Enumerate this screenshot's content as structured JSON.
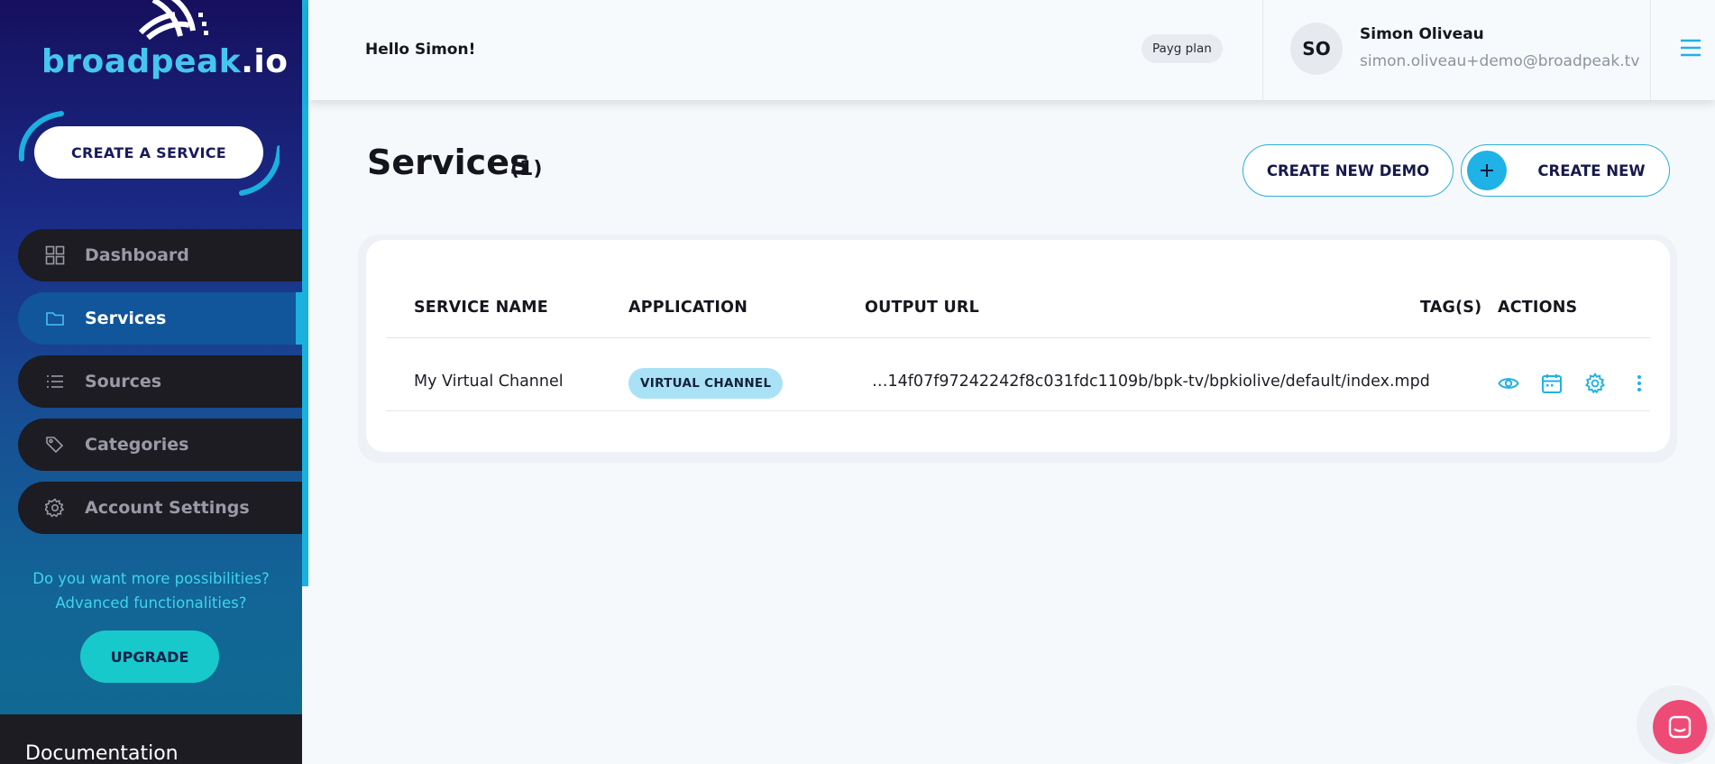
{
  "brand": {
    "name": "broadpeak",
    "suffix": ".io"
  },
  "sidebar": {
    "create_service_label": "CREATE A SERVICE",
    "items": [
      {
        "label": "Dashboard",
        "icon": "grid-icon"
      },
      {
        "label": "Services",
        "icon": "folder-icon",
        "active": true
      },
      {
        "label": "Sources",
        "icon": "list-icon"
      },
      {
        "label": "Categories",
        "icon": "tags-icon"
      },
      {
        "label": "Account Settings",
        "icon": "gear-icon"
      }
    ],
    "promo_line1": "Do you want more possibilities?",
    "promo_line2": "Advanced functionalities?",
    "upgrade_label": "UPGRADE",
    "documentation_label": "Documentation"
  },
  "header": {
    "greeting": "Hello Simon!",
    "plan": "Payg plan",
    "avatar_initials": "SO",
    "user_name": "Simon Oliveau",
    "user_email": "simon.oliveau+demo@broadpeak.tv"
  },
  "main": {
    "title": "Services",
    "count": "(1)",
    "create_demo_label": "CREATE NEW DEMO",
    "create_new_label": "CREATE NEW",
    "table": {
      "columns": [
        "SERVICE NAME",
        "APPLICATION",
        "OUTPUT URL",
        "TAG(S)",
        "ACTIONS"
      ],
      "rows": [
        {
          "service_name": "My Virtual Channel",
          "application": "VIRTUAL CHANNEL",
          "output_url": "…14f07f97242242f8c031fdc1109b/bpk-tv/bpkiolive/default/index.mpd",
          "tags": ""
        }
      ]
    }
  },
  "colors": {
    "accent": "#1fb2e6",
    "sidebar_active": "#11559a",
    "upgrade": "#17c9cb",
    "chat": "#ee4a76"
  }
}
